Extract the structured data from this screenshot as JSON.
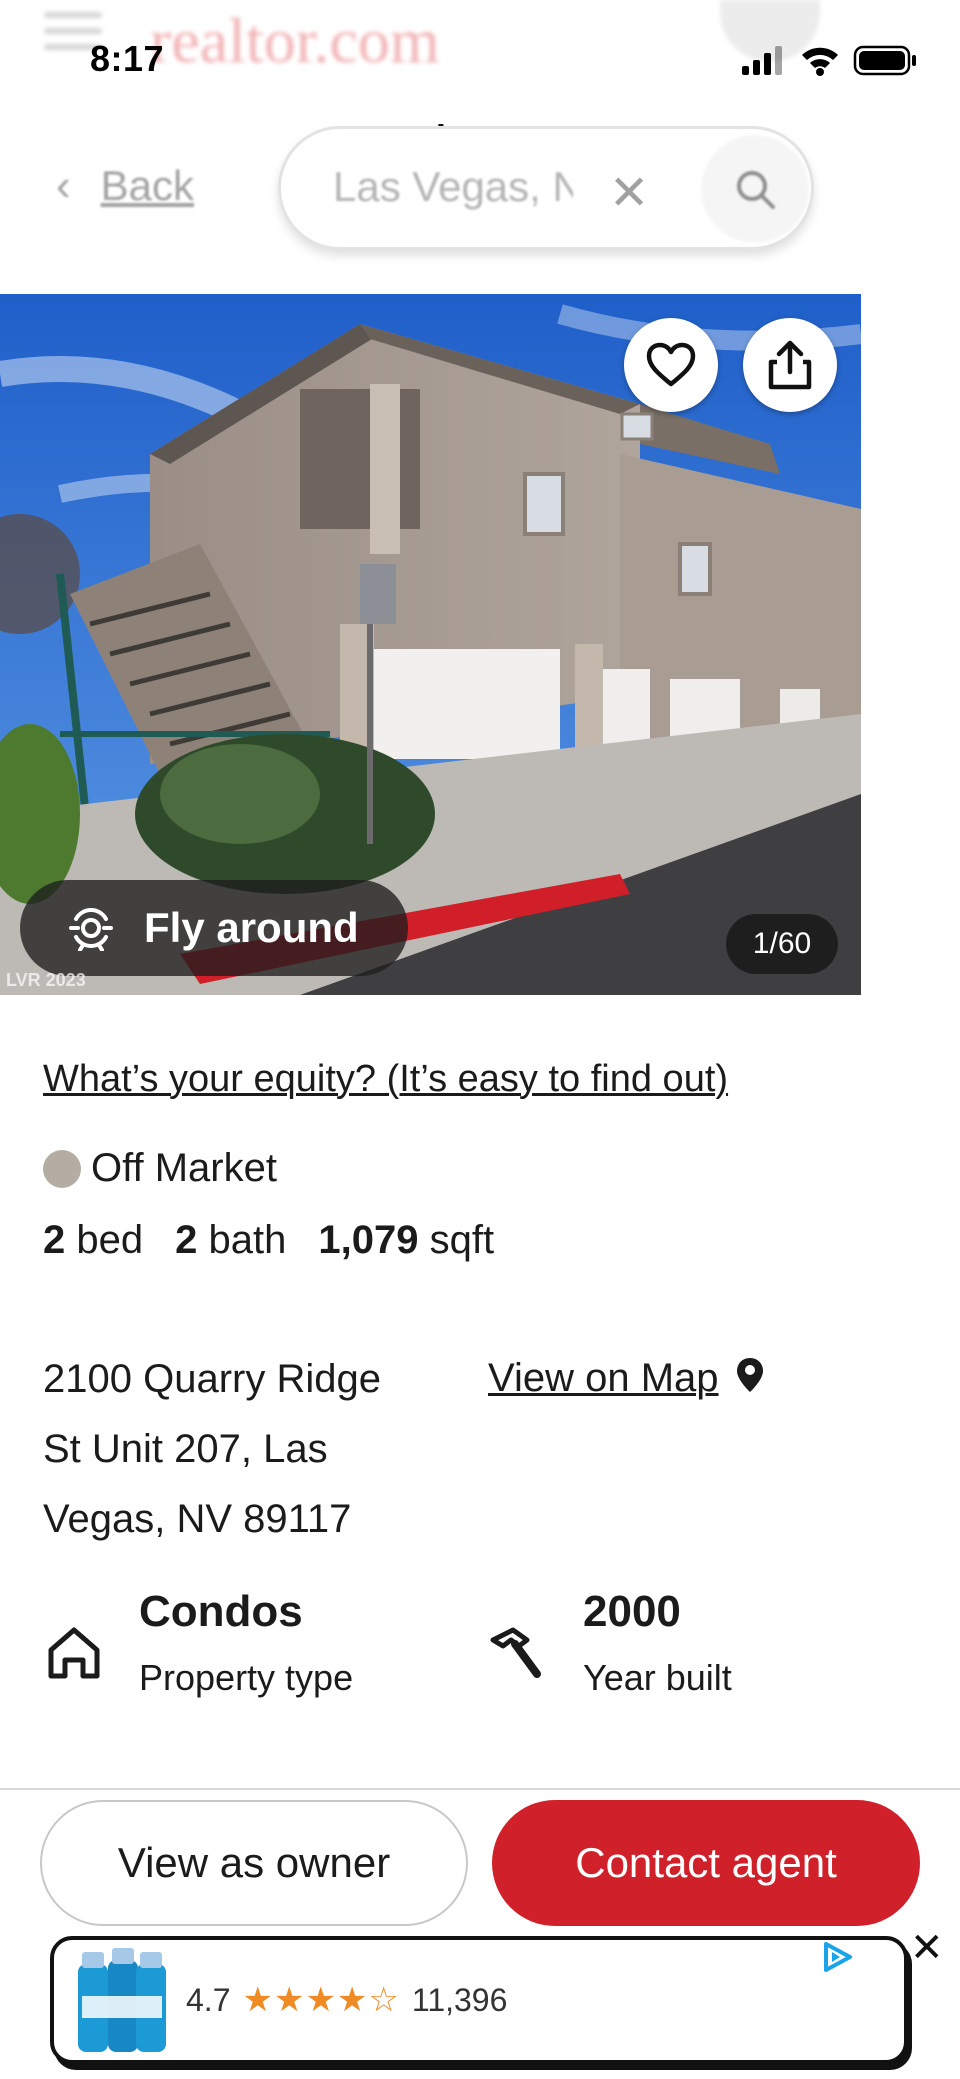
{
  "status_bar": {
    "time": "8:17"
  },
  "header": {
    "site_title": "realtor.com",
    "ghost_logo": "realtor.com",
    "back_label": "Back",
    "search_value": "Las Vegas, NV"
  },
  "photo": {
    "fly_around_label": "Fly around",
    "counter": "1/60",
    "watermark": "LVR 2023"
  },
  "listing": {
    "equity_link": "What’s your equity? (It’s easy to find out)",
    "status": "Off Market",
    "status_color": "#b4ada3",
    "beds_value": "2",
    "beds_unit": "bed",
    "baths_value": "2",
    "baths_unit": "bath",
    "sqft_value": "1,079",
    "sqft_unit": "sqft",
    "address_line1": "2100 Quarry Ridge",
    "address_line2": "St Unit 207, Las",
    "address_line3": "Vegas, NV 89117",
    "map_link": "View on Map",
    "property_type_value": "Condos",
    "property_type_label": "Property type",
    "year_built_value": "2000",
    "year_built_label": "Year built"
  },
  "actions": {
    "view_as_owner": "View as owner",
    "contact_agent": "Contact agent",
    "accent_color": "#d0202a"
  },
  "ad": {
    "rating": "4.7",
    "stars": "★★★★☆",
    "review_count": "11,396"
  }
}
